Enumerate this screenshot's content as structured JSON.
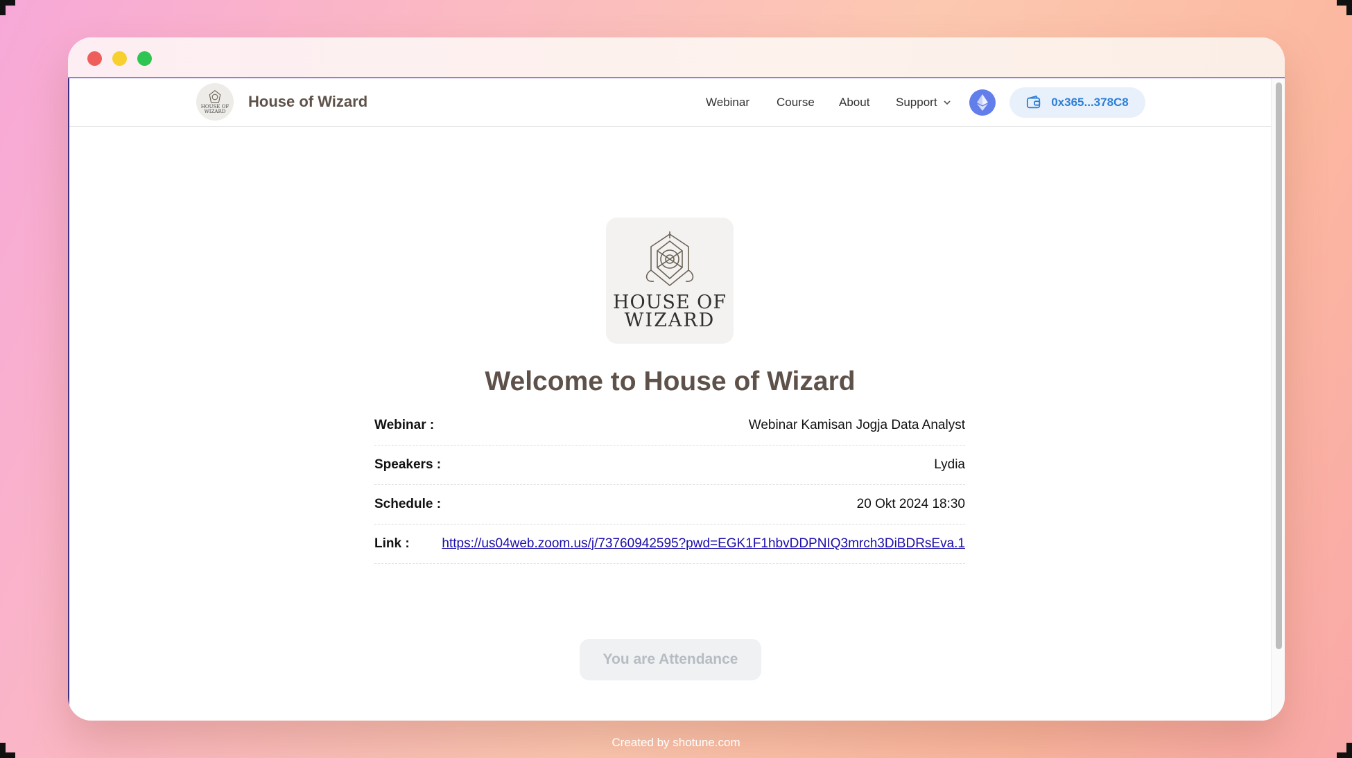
{
  "navbar": {
    "brand_name": "House of Wizard",
    "links": [
      "Webinar",
      "Course",
      "About",
      "Support"
    ],
    "wallet_address": "0x365...378C8"
  },
  "hero": {
    "logo_lines": [
      "HOUSE OF",
      "WIZARD"
    ],
    "welcome_title": "Welcome to House of Wizard"
  },
  "details": {
    "webinar_label": "Webinar :",
    "webinar_value": "Webinar Kamisan Jogja Data Analyst",
    "speakers_label": "Speakers :",
    "speakers_value": "Lydia",
    "schedule_label": "Schedule :",
    "schedule_value": "20 Okt 2024 18:30",
    "link_label": "Link :",
    "link_value": "https://us04web.zoom.us/j/73760942595?pwd=EGK1F1hbvDDPNIQ3mrch3DiBDRsEva.1"
  },
  "attendance_button": "You are Attendance",
  "footer": "Created by shotune.com",
  "colors": {
    "accent_brown": "#5e5149",
    "wallet_blue": "#2d7fd6",
    "eth_purple": "#627eea"
  },
  "icons": [
    "ethereum-icon",
    "wallet-icon",
    "chevron-down-icon",
    "house-of-wizard-emblem"
  ]
}
